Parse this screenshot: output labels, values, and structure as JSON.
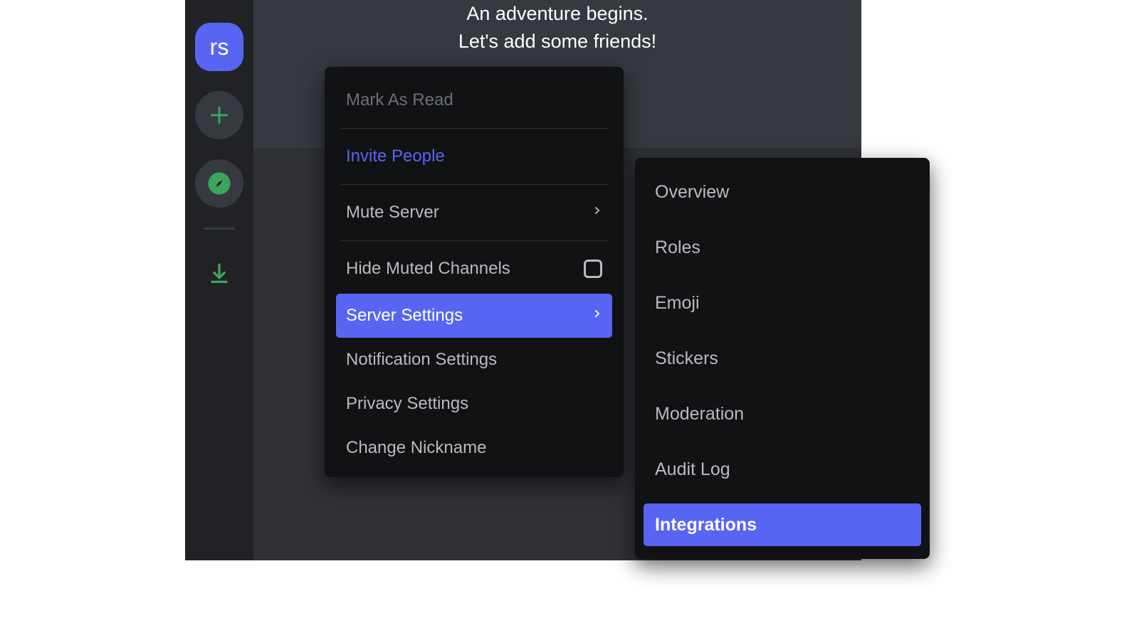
{
  "rail": {
    "server_initials": "rs"
  },
  "onboard": {
    "line1": "An adventure begins.",
    "line2": "Let's add some friends!"
  },
  "context_menu": {
    "mark_as_read": "Mark As Read",
    "invite_people": "Invite People",
    "mute_server": "Mute Server",
    "hide_muted_channels": "Hide Muted Channels",
    "server_settings": "Server Settings",
    "notification_settings": "Notification Settings",
    "privacy_settings": "Privacy Settings",
    "change_nickname": "Change Nickname"
  },
  "server_settings_submenu": {
    "overview": "Overview",
    "roles": "Roles",
    "emoji": "Emoji",
    "stickers": "Stickers",
    "moderation": "Moderation",
    "audit_log": "Audit Log",
    "integrations": "Integrations"
  }
}
